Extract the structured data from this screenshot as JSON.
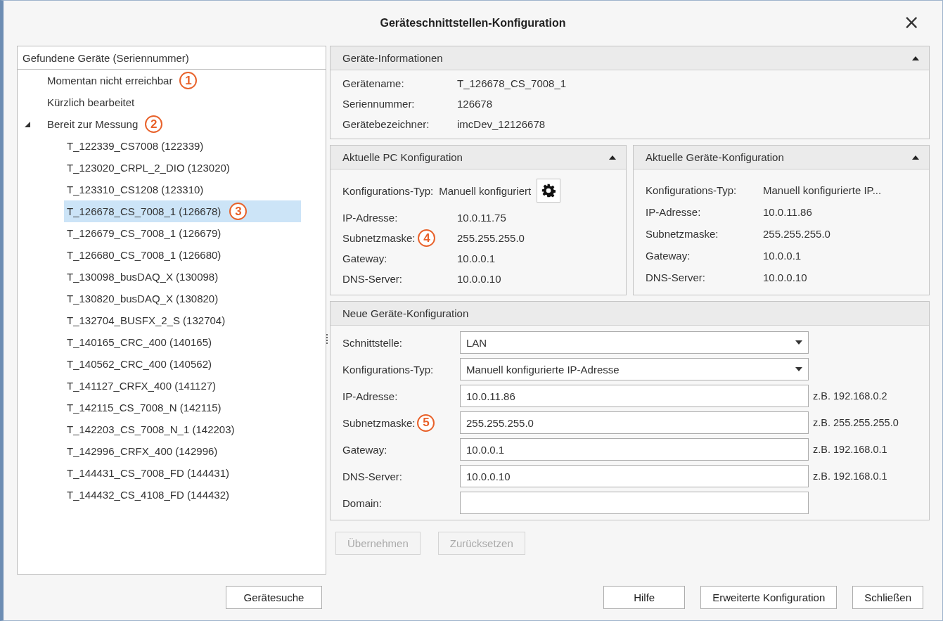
{
  "window": {
    "title": "Geräteschnittstellen-Konfiguration",
    "close": "×"
  },
  "device_tree": {
    "header": "Gefundene Geräte (Seriennummer)",
    "items": [
      {
        "label": "Momentan nicht erreichbar",
        "badge": "1"
      },
      {
        "label": "Kürzlich bearbeitet"
      },
      {
        "label": "Bereit zur Messung",
        "badge": "2",
        "expanded": true,
        "children": [
          {
            "label": "T_122339_CS7008 (122339)",
            "selected": false
          },
          {
            "label": "T_123020_CRPL_2_DIO (123020)",
            "selected": false
          },
          {
            "label": "T_123310_CS1208 (123310)",
            "selected": false
          },
          {
            "label": "T_126678_CS_7008_1 (126678)",
            "selected": true,
            "badge": "3"
          },
          {
            "label": "T_126679_CS_7008_1 (126679)",
            "selected": false
          },
          {
            "label": "T_126680_CS_7008_1 (126680)",
            "selected": false
          },
          {
            "label": "T_130098_busDAQ_X (130098)",
            "selected": false
          },
          {
            "label": "T_130820_busDAQ_X (130820)",
            "selected": false
          },
          {
            "label": "T_132704_BUSFX_2_S (132704)",
            "selected": false
          },
          {
            "label": "T_140165_CRC_400 (140165)",
            "selected": false
          },
          {
            "label": "T_140562_CRC_400 (140562)",
            "selected": false
          },
          {
            "label": "T_141127_CRFX_400 (141127)",
            "selected": false
          },
          {
            "label": "T_142115_CS_7008_N (142115)",
            "selected": false
          },
          {
            "label": "T_142203_CS_7008_N_1 (142203)",
            "selected": false
          },
          {
            "label": "T_142996_CRFX_400 (142996)",
            "selected": false
          },
          {
            "label": "T_144431_CS_7008_FD (144431)",
            "selected": false
          },
          {
            "label": "T_144432_CS_4108_FD (144432)",
            "selected": false
          }
        ]
      }
    ],
    "search_button": "Gerätesuche"
  },
  "device_info": {
    "title": "Geräte-Informationen",
    "rows": [
      {
        "label": "Gerätename:",
        "value": "T_126678_CS_7008_1"
      },
      {
        "label": "Seriennummer:",
        "value": "126678"
      },
      {
        "label": "Gerätebezeichner:",
        "value": "imcDev_12126678"
      }
    ]
  },
  "pc_config": {
    "title": "Aktuelle PC Konfiguration",
    "type_label": "Konfigurations-Typ:",
    "type_value": "Manuell konfiguriert",
    "rows": [
      {
        "label": "IP-Adresse:",
        "value": "10.0.11.75"
      },
      {
        "label": "Subnetzmaske:",
        "value": "255.255.255.0",
        "badge": "4"
      },
      {
        "label": "Gateway:",
        "value": "10.0.0.1"
      },
      {
        "label": "DNS-Server:",
        "value": "10.0.0.10"
      }
    ]
  },
  "device_config": {
    "title": "Aktuelle Geräte-Konfiguration",
    "rows": [
      {
        "label": "Konfigurations-Typ:",
        "value": "Manuell konfigurierte IP..."
      },
      {
        "label": "IP-Adresse:",
        "value": "10.0.11.86"
      },
      {
        "label": "Subnetzmaske:",
        "value": "255.255.255.0"
      },
      {
        "label": "Gateway:",
        "value": "10.0.0.1"
      },
      {
        "label": "DNS-Server:",
        "value": "10.0.0.10"
      }
    ]
  },
  "new_config": {
    "title": "Neue Geräte-Konfiguration",
    "fields": [
      {
        "kind": "dropdown",
        "label": "Schnittstelle:",
        "value": "LAN"
      },
      {
        "kind": "dropdown",
        "label": "Konfigurations-Typ:",
        "value": "Manuell konfigurierte IP-Adresse"
      },
      {
        "kind": "input",
        "label": "IP-Adresse:",
        "value": "10.0.11.86",
        "example": "z.B. 192.168.0.2"
      },
      {
        "kind": "input",
        "label": "Subnetzmaske:",
        "value": "255.255.255.0",
        "example": "z.B. 255.255.255.0",
        "badge": "5"
      },
      {
        "kind": "input",
        "label": "Gateway:",
        "value": "10.0.0.1",
        "example": "z.B. 192.168.0.1"
      },
      {
        "kind": "input",
        "label": "DNS-Server:",
        "value": "10.0.0.10",
        "example": "z.B. 192.168.0.1"
      },
      {
        "kind": "input",
        "label": "Domain:"
      }
    ]
  },
  "actions": [
    {
      "label": "Übernehmen",
      "disabled": true
    },
    {
      "label": "Zurücksetzen",
      "disabled": true
    }
  ],
  "footer_buttons": [
    "Hilfe",
    "Erweiterte Konfiguration",
    "Schließen"
  ]
}
